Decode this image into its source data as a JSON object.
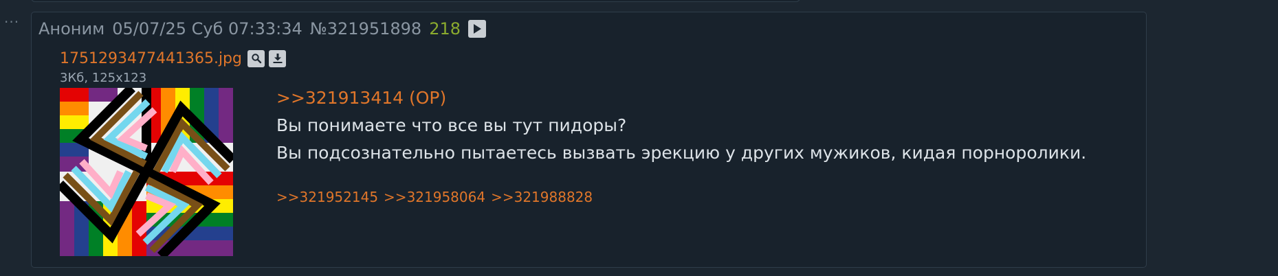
{
  "thread": {
    "menu_dots": "···"
  },
  "post": {
    "author": "Аноним",
    "date": "05/07/25 Суб 07:33:34",
    "number": "№321951898",
    "reply_count": "218",
    "play_icon": "play-icon",
    "file": {
      "name": "1751293477441365.jpg",
      "meta": "3Кб, 125x123",
      "search_icon": "magnifier-icon",
      "download_icon": "download-icon"
    },
    "quote_link": ">>321913414 (OP)",
    "body_lines": [
      "Вы понимаете что все вы тут пидоры?",
      "Вы подсознательно пытаетесь вызвать эрекцию у других мужиков, кидая порноролики."
    ],
    "replies": [
      ">>321952145",
      ">>321958064",
      ">>321988828"
    ]
  },
  "colors": {
    "background": "#1c2630",
    "post_background": "#18222c",
    "link": "#e0762a",
    "reply_count": "#8bab2e",
    "text": "#dde3e8",
    "meta": "#8a96a2"
  }
}
